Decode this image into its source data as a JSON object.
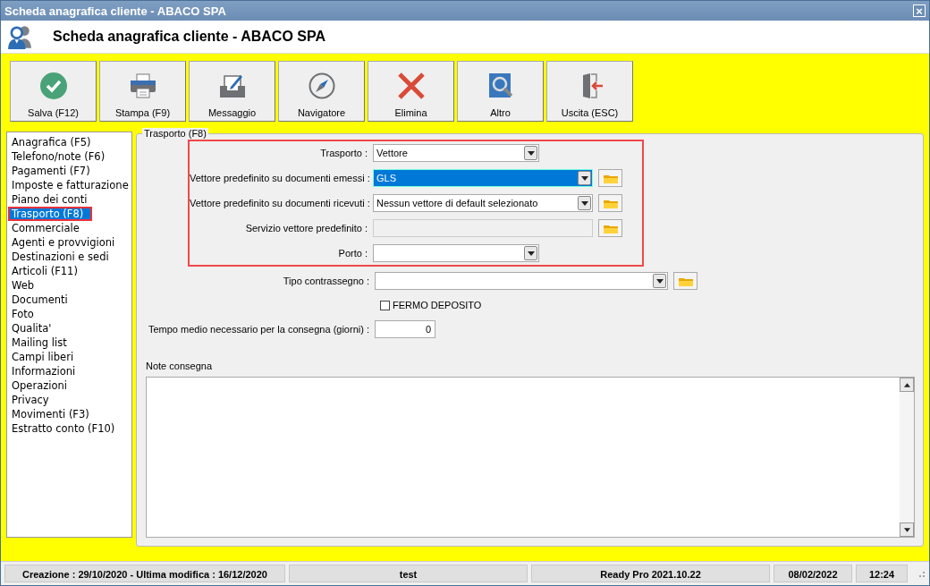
{
  "window": {
    "title": "Scheda anagrafica cliente - ABACO SPA",
    "close_glyph": "×"
  },
  "header": {
    "title": "Scheda anagrafica cliente - ABACO SPA"
  },
  "toolbar": [
    {
      "label": "Salva (F12)"
    },
    {
      "label": "Stampa (F9)"
    },
    {
      "label": "Messaggio"
    },
    {
      "label": "Navigatore"
    },
    {
      "label": "Elimina"
    },
    {
      "label": "Altro"
    },
    {
      "label": "Uscita (ESC)"
    }
  ],
  "sidebar": {
    "items": [
      {
        "label": "Anagrafica (F5)",
        "selected": false,
        "highlighted": false
      },
      {
        "label": "Telefono/note (F6)",
        "selected": false,
        "highlighted": false
      },
      {
        "label": "Pagamenti (F7)",
        "selected": false,
        "highlighted": false
      },
      {
        "label": "Imposte e fatturazione",
        "selected": false,
        "highlighted": false
      },
      {
        "label": "Piano dei conti",
        "selected": false,
        "highlighted": false
      },
      {
        "label": "Trasporto (F8)",
        "selected": true,
        "highlighted": true
      },
      {
        "label": "Commerciale",
        "selected": false,
        "highlighted": false
      },
      {
        "label": "Agenti e provvigioni",
        "selected": false,
        "highlighted": false
      },
      {
        "label": "Destinazioni e sedi",
        "selected": false,
        "highlighted": false
      },
      {
        "label": "Articoli (F11)",
        "selected": false,
        "highlighted": false
      },
      {
        "label": "Web",
        "selected": false,
        "highlighted": false
      },
      {
        "label": "Documenti",
        "selected": false,
        "highlighted": false
      },
      {
        "label": "Foto",
        "selected": false,
        "highlighted": false
      },
      {
        "label": "Qualita'",
        "selected": false,
        "highlighted": false
      },
      {
        "label": "Mailing list",
        "selected": false,
        "highlighted": false
      },
      {
        "label": "Campi liberi",
        "selected": false,
        "highlighted": false
      },
      {
        "label": "Informazioni",
        "selected": false,
        "highlighted": false
      },
      {
        "label": "Operazioni",
        "selected": false,
        "highlighted": false
      },
      {
        "label": "Privacy",
        "selected": false,
        "highlighted": false
      },
      {
        "label": "Movimenti (F3)",
        "selected": false,
        "highlighted": false
      },
      {
        "label": "Estratto conto (F10)",
        "selected": false,
        "highlighted": false
      }
    ]
  },
  "panel": {
    "title": "Trasporto (F8)",
    "highlighted_rows": [
      {
        "kind": "select",
        "label": "Trasporto :",
        "value": "Vettore",
        "focused": false,
        "lookup": false,
        "disabled": false
      },
      {
        "kind": "select",
        "label": "Vettore predefinito su documenti emessi :",
        "value": "GLS",
        "focused": true,
        "lookup": true,
        "disabled": false
      },
      {
        "kind": "select",
        "label": "Vettore predefinito su documenti ricevuti :",
        "value": "Nessun vettore di default selezionato",
        "focused": false,
        "lookup": true,
        "disabled": false
      },
      {
        "kind": "input",
        "label": "Servizio vettore predefinito :",
        "focused": false,
        "lookup": true,
        "disabled": true
      },
      {
        "kind": "select",
        "label": "Porto :",
        "focused": false,
        "lookup": false,
        "disabled": false
      }
    ],
    "rows": [
      {
        "kind": "select",
        "label": "Tipo contrassegno :",
        "focused": false,
        "lookup": true,
        "disabled": false
      },
      {
        "kind": "checkbox",
        "label": "FERMO DEPOSITO",
        "checked": false
      },
      {
        "kind": "number",
        "label": "Tempo medio necessario per la consegna (giorni) :",
        "value": "0"
      }
    ],
    "notes": {
      "label": "Note consegna"
    }
  },
  "status_bar": [
    {
      "text": "Creazione : 29/10/2020 - Ultima modifica : 16/12/2020"
    },
    {
      "text": "test"
    },
    {
      "text": "Ready Pro 2021.10.22"
    },
    {
      "text": "08/02/2022"
    },
    {
      "text": "12:24"
    }
  ]
}
